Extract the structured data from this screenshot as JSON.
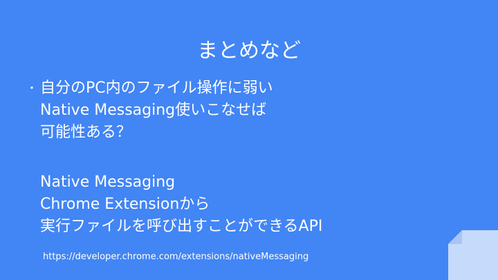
{
  "slide": {
    "title": "まとめなど",
    "bullet_symbol": "・",
    "bullet_text": "自分のPC内のファイル操作に弱い",
    "continuation_lines": [
      "Native Messaging使いこなせば",
      "可能性ある？"
    ],
    "paragraph_lines": [
      "Native Messaging",
      "Chrome Extensionから",
      "実行ファイルを呼び出すことができるAPI"
    ],
    "url": "https://developer.chrome.com/extensions/nativeMessaging"
  },
  "colors": {
    "background": "#4285f4",
    "text": "#ffffff",
    "corner_fold": "#c6dafc"
  }
}
